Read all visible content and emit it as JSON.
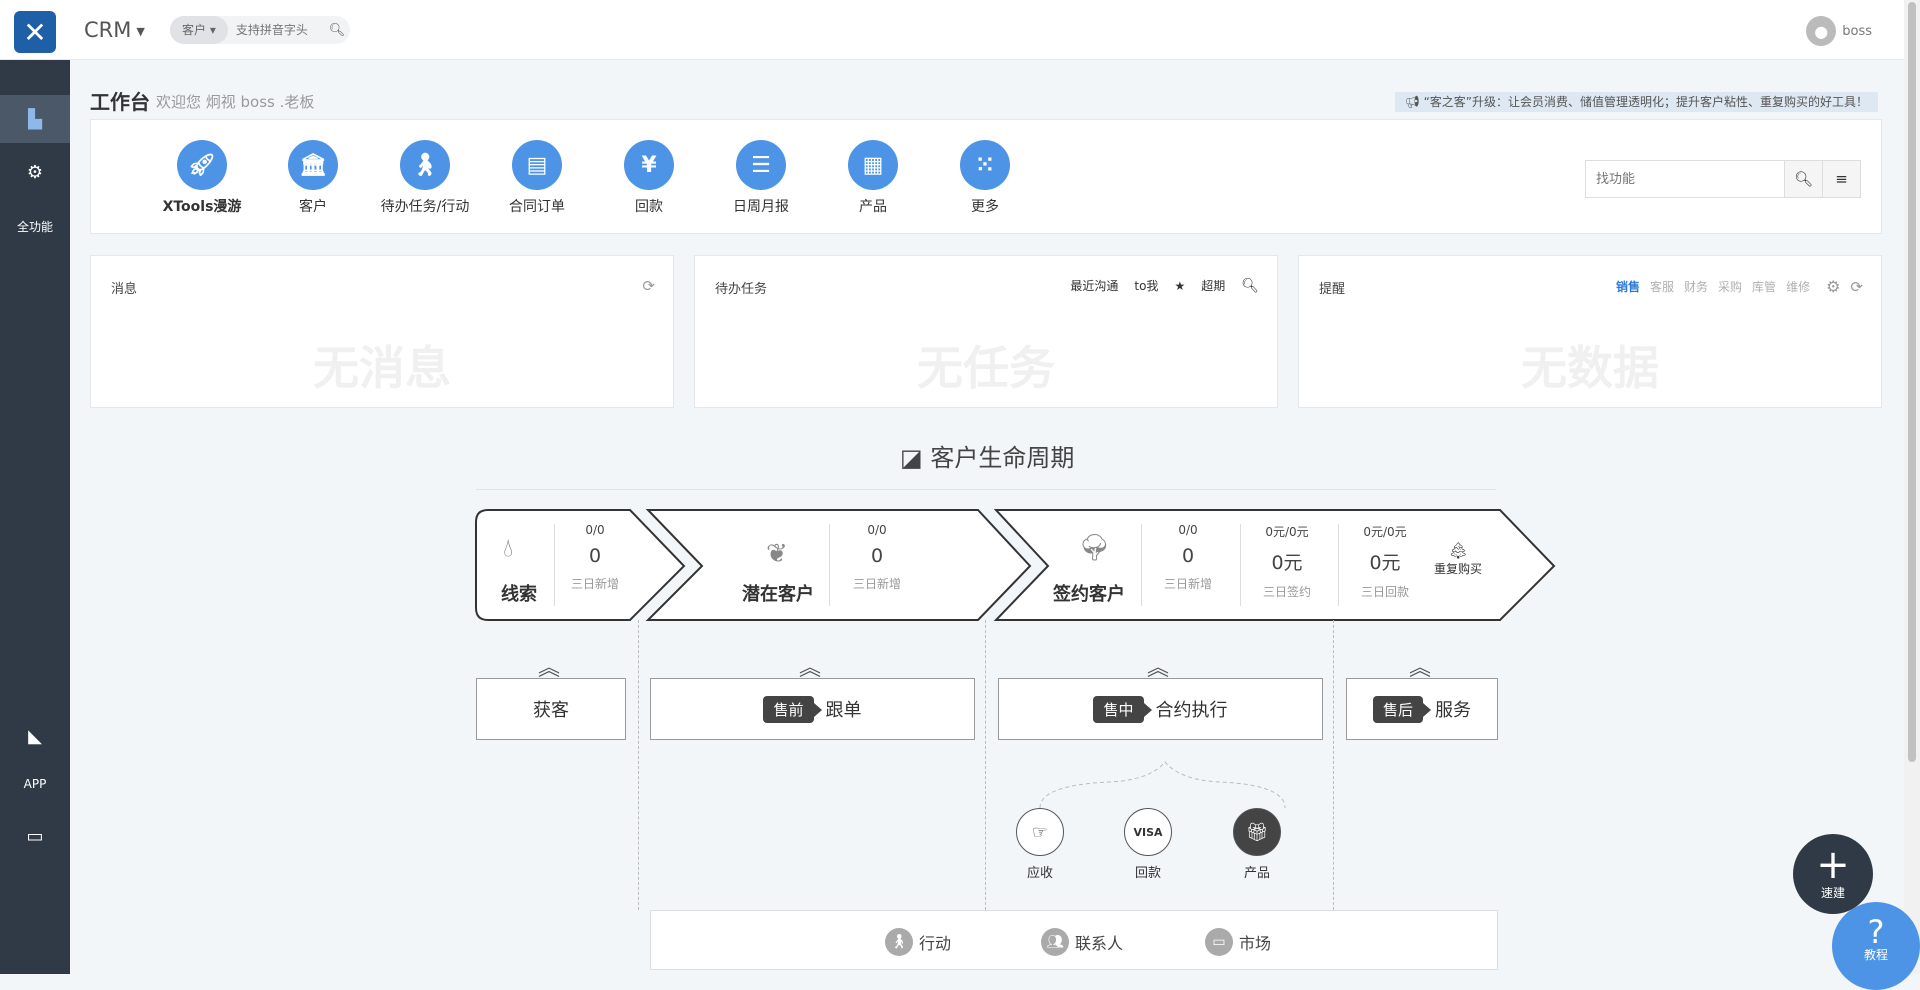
{
  "header": {
    "app_name": "CRM",
    "search_type": "客户",
    "search_placeholder": "支持拼音字头",
    "user_name": "boss"
  },
  "sidebar": {
    "items": [
      {
        "icon": "building-icon",
        "label": ""
      },
      {
        "icon": "gears-icon",
        "label": ""
      },
      {
        "icon": "",
        "label": "全功能"
      },
      {
        "icon": "area-chart-icon",
        "label": ""
      },
      {
        "icon": "",
        "label": "APP"
      },
      {
        "icon": "monitor-icon",
        "label": ""
      }
    ]
  },
  "page": {
    "title": "工作台",
    "subtitle": "欢迎您 炯视 boss .老板",
    "notice": "“客之客”升级：让会员消费、储值管理透明化；提升客户粘性、重复购买的好工具！"
  },
  "quick": {
    "items": [
      {
        "label": "XTools漫游",
        "icon": "rocket-icon"
      },
      {
        "label": "客户",
        "icon": "bank-icon"
      },
      {
        "label": "待办任务/行动",
        "icon": "walking-icon"
      },
      {
        "label": "合同订单",
        "icon": "file-icon"
      },
      {
        "label": "回款",
        "icon": "yen-icon"
      },
      {
        "label": "日周月报",
        "icon": "report-icon"
      },
      {
        "label": "产品",
        "icon": "grid-icon"
      },
      {
        "label": "更多",
        "icon": "more-icon"
      }
    ],
    "search_placeholder": "找功能"
  },
  "cards": {
    "messages": {
      "title": "消息",
      "empty": "无消息"
    },
    "tasks": {
      "title": "待办任务",
      "empty": "无任务",
      "tools": [
        "最近沟通",
        "to我",
        "★",
        "超期"
      ]
    },
    "reminders": {
      "title": "提醒",
      "empty": "无数据",
      "tabs": [
        "销售",
        "客服",
        "财务",
        "采购",
        "库管",
        "维修"
      ]
    }
  },
  "lifecycle": {
    "title": "客户生命周期",
    "stages": [
      {
        "name": "线索",
        "icon": "drop-icon",
        "stats": [
          {
            "top": "0/0",
            "value": "0",
            "label": "三日新增"
          }
        ]
      },
      {
        "name": "潜在客户",
        "icon": "leaf-icon",
        "stats": [
          {
            "top": "0/0",
            "value": "0",
            "label": "三日新增"
          }
        ]
      },
      {
        "name": "签约客户",
        "icon": "tree-icon",
        "stats": [
          {
            "top": "0/0",
            "value": "0",
            "label": "三日新增"
          },
          {
            "top": "0元/0元",
            "value": "0元",
            "label": "三日签约"
          },
          {
            "top": "0元/0元",
            "value": "0元",
            "label": "三日回款"
          }
        ],
        "extra": "重复购买"
      }
    ],
    "phases": [
      {
        "tag": "",
        "label": "获客"
      },
      {
        "tag": "售前",
        "label": "跟单"
      },
      {
        "tag": "售中",
        "label": "合约执行"
      },
      {
        "tag": "售后",
        "label": "服务"
      }
    ],
    "sub": [
      {
        "label": "应收",
        "icon": "hand-icon"
      },
      {
        "label": "回款",
        "icon": "visa-icon"
      },
      {
        "label": "产品",
        "icon": "gift-icon"
      }
    ],
    "bottom": [
      {
        "label": "行动",
        "icon": "walking-icon"
      },
      {
        "label": "联系人",
        "icon": "users-icon"
      },
      {
        "label": "市场",
        "icon": "monitor-icon"
      }
    ]
  },
  "fab": {
    "label": "速建"
  },
  "help": {
    "label": "教程"
  }
}
